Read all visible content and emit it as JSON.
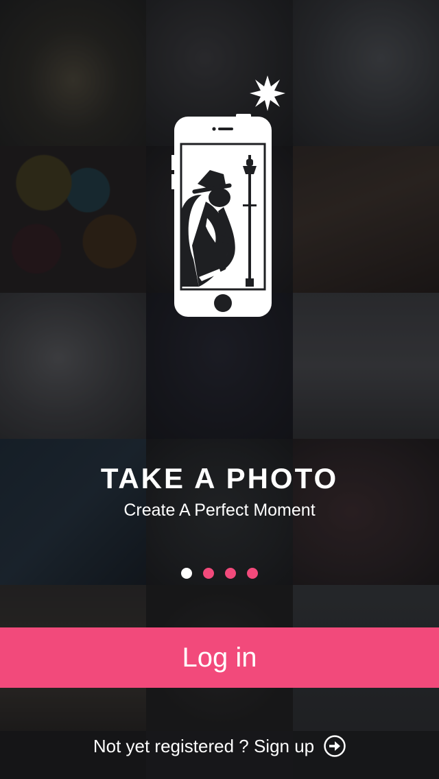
{
  "onboarding": {
    "title": "TAKE A PHOTO",
    "subtitle": "Create A Perfect Moment",
    "pager": {
      "page_count": 4,
      "active_page": 1
    },
    "illustration_icon": "phone-camera-icon"
  },
  "actions": {
    "login_label": "Log in",
    "signup_label": "Not yet registered ? Sign up",
    "signup_icon": "arrow-right-circle-icon"
  },
  "colors": {
    "accent": "#f24a7b",
    "active_dot": "#ffffff",
    "text": "#ffffff"
  }
}
